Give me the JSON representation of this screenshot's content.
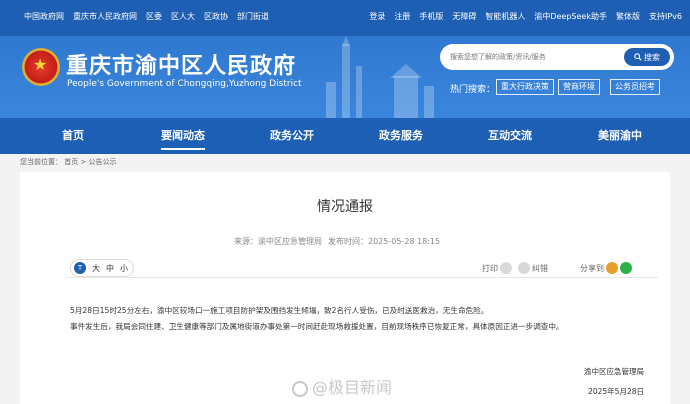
{
  "topbar": {
    "left_links": [
      "中国政府网",
      "重庆市人民政府网",
      "区委",
      "区人大",
      "区政协",
      "部门街道"
    ],
    "right_links": [
      "登录",
      "注册",
      "手机版",
      "无障碍",
      "智能机器人",
      "渝中DeepSeek助手",
      "繁体版",
      "支持IPv6"
    ]
  },
  "header": {
    "title": "重庆市渝中区人民政府",
    "subtitle": "People's Government of Chongqing,Yuzhong District",
    "search_placeholder": "搜索您想了解的政策/资讯/服务",
    "search_button": "搜索",
    "hot_label": "热门搜索：",
    "hot_tags": [
      "重大行政决策",
      "营商环境",
      "公务员招考"
    ]
  },
  "nav": {
    "items": [
      "首页",
      "要闻动态",
      "政务公开",
      "政务服务",
      "互动交流",
      "美丽渝中"
    ],
    "active": "要闻动态"
  },
  "breadcrumb": {
    "label": "您当前位置：",
    "path": "首页 > 公告公示"
  },
  "article": {
    "title": "情况通报",
    "source_label": "来源：",
    "source": "渝中区应急管理局",
    "date_label": "发布时间：",
    "date": "2025-05-28 18:15",
    "font_sizes": [
      "大",
      "中",
      "小"
    ],
    "print_label": "打印",
    "correction_label": "纠错",
    "share_label": "分享到",
    "paragraph1": "5月28日15时25分左右，渝中区较场口一施工项目防护架及围挡发生倾塌，致2名行人受伤，已及时送医救治，无生命危险。",
    "paragraph2": "事件发生后，我局会同住建、卫生健康等部门及属地街道办事处第一时间赶赴现场救援处置，目前现场秩序已恢复正常，具体原因正进一步调查中。",
    "signature": "渝中区应急管理局",
    "sign_date": "2025年5月28日"
  },
  "watermark": "@极目新闻",
  "colors": {
    "topbar": "#1e5fb3",
    "header": "#3580d8",
    "nav": "#1c5fb5",
    "wechat": "#2db24a",
    "weibo": "#e8a02a"
  }
}
